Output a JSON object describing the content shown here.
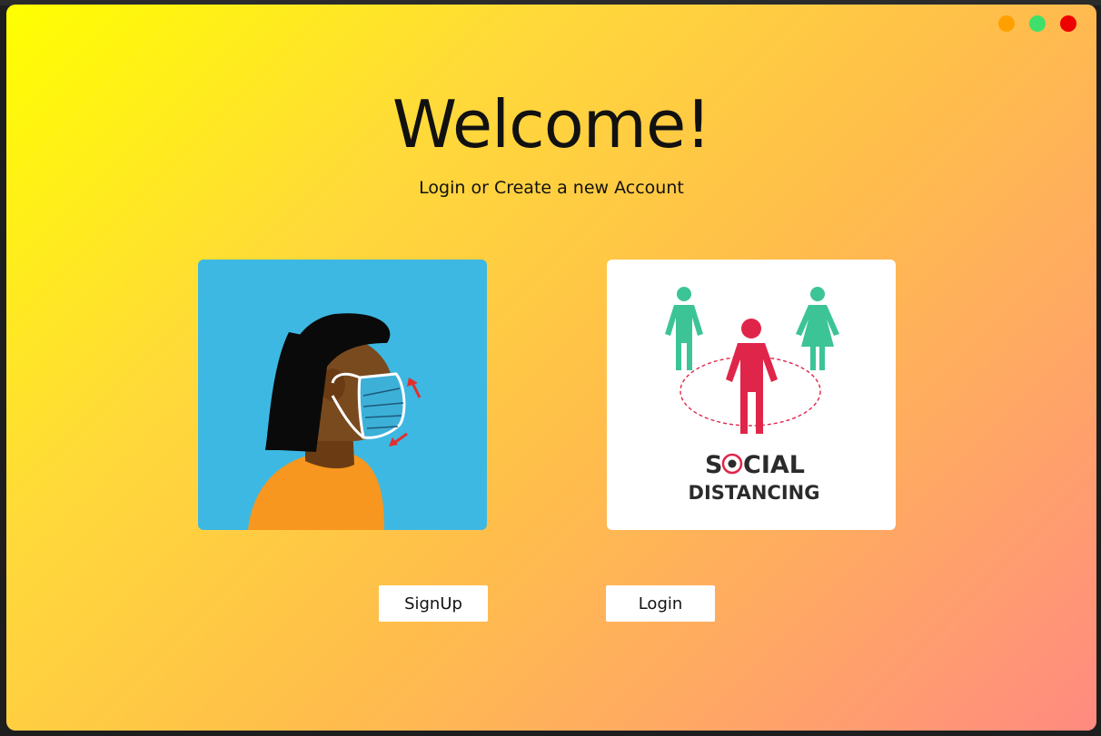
{
  "window": {
    "controls": [
      {
        "name": "minimize",
        "color": "#ffa000"
      },
      {
        "name": "maximize",
        "color": "#3ee06a"
      },
      {
        "name": "close",
        "color": "#ee0000"
      }
    ]
  },
  "header": {
    "title": "Welcome!",
    "subtitle": "Login or Create a new Account"
  },
  "cards": {
    "mask": {
      "icon": "face-mask-illustration"
    },
    "social": {
      "icon": "social-distancing-illustration",
      "line1_start": "S",
      "line1_end": "CIAL",
      "line2": "DISTANCING"
    }
  },
  "actions": {
    "signup_label": "SignUp",
    "login_label": "Login"
  },
  "colors": {
    "gradient_start": "#ffff00",
    "gradient_end": "#ff8a80",
    "mask_card_bg": "#3db8e2",
    "figure_green": "#3cc497",
    "figure_red": "#e0254a"
  }
}
